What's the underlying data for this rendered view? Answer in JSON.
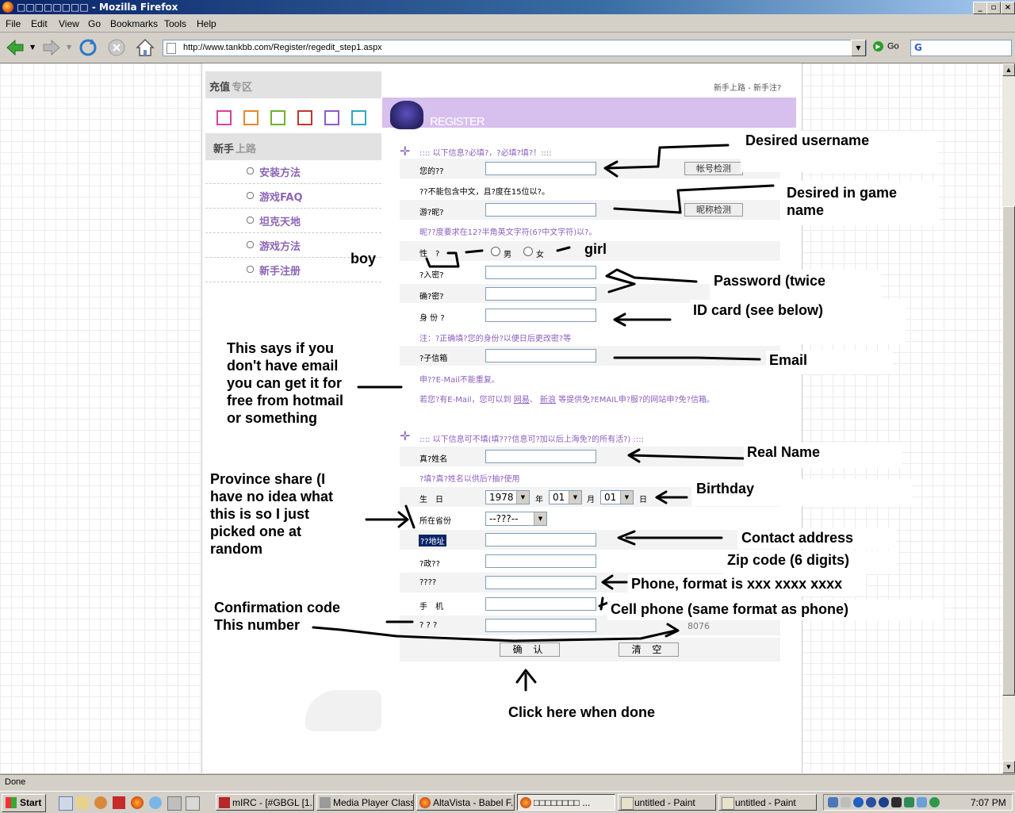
{
  "window": {
    "title": "□□□□□□□□ - Mozilla Firefox",
    "controls": [
      "_",
      "▫",
      "×"
    ]
  },
  "menu": [
    "File",
    "Edit",
    "View",
    "Go",
    "Bookmarks",
    "Tools",
    "Help"
  ],
  "nav": {
    "url": "http://www.tankbb.com/Register/regedit_step1.aspx",
    "go_label": "Go",
    "search_text": "G"
  },
  "sidebar": {
    "header1_a": "充值",
    "header1_b": "专区",
    "header2_a": "新手",
    "header2_b": "上路",
    "items": [
      "安装方法",
      "游戏FAQ",
      "坦克天地",
      "游戏方法",
      "新手注册"
    ],
    "icon_colors": [
      "#d6409a",
      "#e8882a",
      "#6fb22e",
      "#c0392b",
      "#8d5ac7",
      "#2ea8c2"
    ]
  },
  "page": {
    "top_right": "新手上路 - 新手注?",
    "banner_text": "REGISTER"
  },
  "form": {
    "section1": ":::: 以下信息?必填?，?必填?填?！::::",
    "username_label": "您的??",
    "username_check": "帐号检测",
    "username_hint": "??不能包含中文，且?度在15位以?。",
    "nick_label": "游?昵?",
    "nick_check": "昵称检测",
    "nick_hint": "昵??度要求在12?半角英文字符(6?中文字符)以?。",
    "gender_label": "性　?",
    "gender_male": "男",
    "gender_female": "女",
    "password_label": "?入密?",
    "password2_label": "确?密?",
    "id_label": "身 份 ?",
    "id_hint": "注：?正确填?您的身份?以便日后更改密?等",
    "email_label": "?子信箱",
    "email_hint1": "申??E-Mail不能重复。",
    "email_hint2_a": "若您?有E-Mail，您可以到",
    "email_hint2_link1": "网易",
    "email_hint2_sep": "、",
    "email_hint2_link2": "新浪",
    "email_hint2_b": "等提供免?EMAIL申?服?的网站申?免?信箱。",
    "section2": ":::: 以下信息可不填(填???信息可?加以后上海免?的所有活?) ::::",
    "realname_label": "真?姓名",
    "realname_hint": "?填?真?姓名以供后?抽?使用",
    "birthday_label": "生　日",
    "birth_year": "1978",
    "birth_year_unit": "年",
    "birth_month": "01",
    "birth_month_unit": "月",
    "birth_day": "01",
    "birth_day_unit": "日",
    "province_label": "所在省份",
    "province_value": "--???--",
    "address_label": "??地址",
    "zip_label": "?政??",
    "phone_label": "????",
    "cell_label": "手　机",
    "code_label": "? ? ?",
    "code_value": "8076",
    "submit": "确 认",
    "clear": "清 空"
  },
  "annotations": {
    "username": "Desired username",
    "ingame": "Desired in game name",
    "boy": "boy",
    "girl": "girl",
    "password": "Password (twice",
    "idcard": "ID card (see below)",
    "email_note": "This says if you don't have email you can get it for free from hotmail or something",
    "email": "Email",
    "realname": "Real Name",
    "province": "Province share (I have no idea what this is so I just picked one at random",
    "birthday": "Birthday",
    "address": "Contact address",
    "zip": "Zip code (6 digits)",
    "phone": "Phone, format is xxx xxxx xxxx",
    "cell": "Cell phone (same format as phone)",
    "confirm_code": "Confirmation code This number",
    "click_done": "Click here when done"
  },
  "status": "Done",
  "taskbar": {
    "start": "Start",
    "tasks": [
      "mIRC - [#GBGL [1...",
      "Media Player Classic",
      "AltaVista - Babel F...",
      "□□□□□□□□ ...",
      "untitled - Paint",
      "untitled - Paint"
    ],
    "clock": "7:07 PM"
  }
}
